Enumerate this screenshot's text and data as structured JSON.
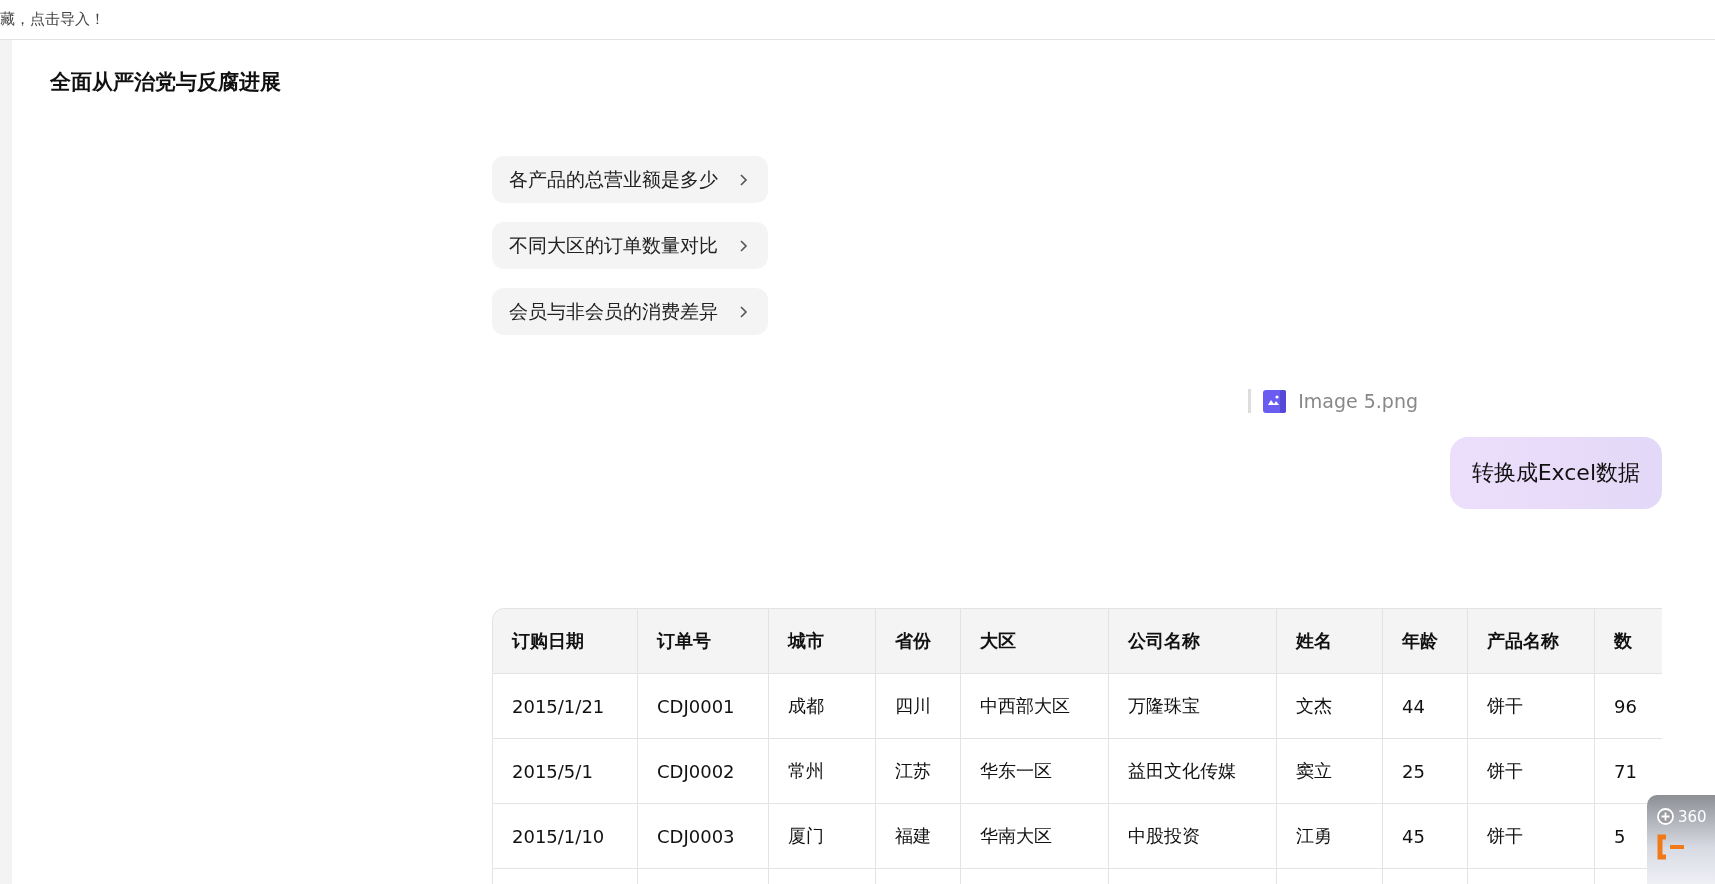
{
  "top_bar": {
    "text": "藏，点击导入！"
  },
  "title": "全面从严治党与反腐进展",
  "suggestions": [
    {
      "text": "各产品的总营业额是多少"
    },
    {
      "text": "不同大区的订单数量对比"
    },
    {
      "text": "会员与非会员的消费差异"
    }
  ],
  "attachment": {
    "file_name": "Image 5.png"
  },
  "message": {
    "text": "转换成Excel数据"
  },
  "table": {
    "columns": [
      "订购日期",
      "订单号",
      "城市",
      "省份",
      "大区",
      "公司名称",
      "姓名",
      "年龄",
      "产品名称",
      "数"
    ],
    "rows": [
      [
        "2015/1/21",
        "CDJ0001",
        "成都",
        "四川",
        "中西部大区",
        "万隆珠宝",
        "文杰",
        "44",
        "饼干",
        "96"
      ],
      [
        "2015/5/1",
        "CDJ0002",
        "常州",
        "江苏",
        "华东一区",
        "益田文化传媒",
        "窦立",
        "25",
        "饼干",
        "71"
      ],
      [
        "2015/1/10",
        "CDJ0003",
        "厦门",
        "福建",
        "华南大区",
        "中股投资",
        "江勇",
        "45",
        "饼干",
        "5"
      ]
    ]
  },
  "overlay_widget": {
    "label": "360"
  }
}
